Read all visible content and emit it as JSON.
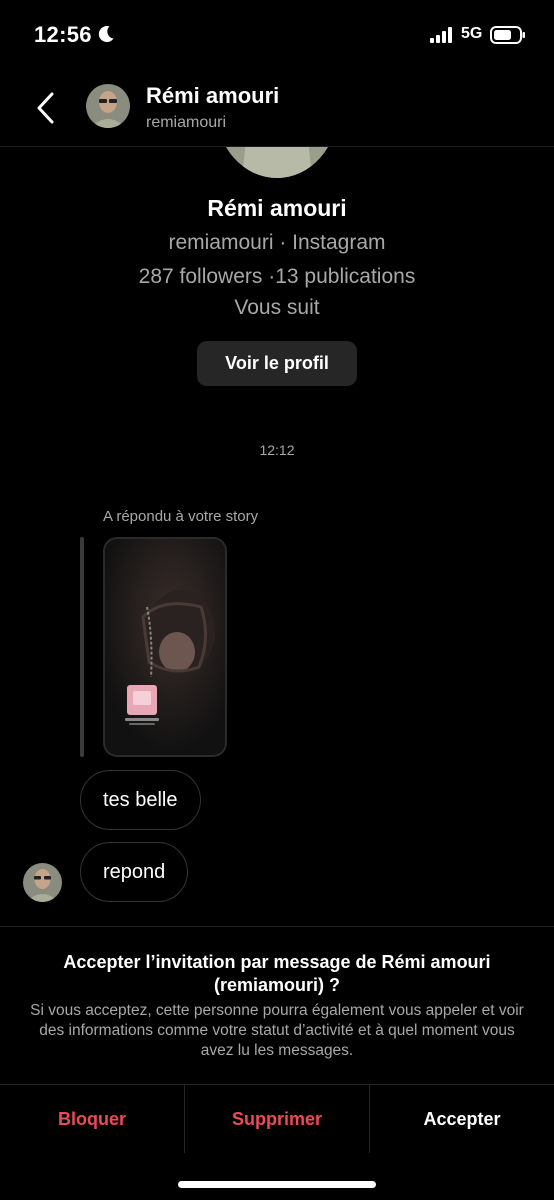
{
  "status_bar": {
    "time": "12:56",
    "network": "5G"
  },
  "header": {
    "name": "Rémi amouri",
    "username": "remiamouri"
  },
  "profile": {
    "name": "Rémi amouri",
    "subtitle": "remiamouri · Instagram",
    "stats": "287 followers ·13 publications",
    "follow_status": "Vous suit",
    "view_profile_label": "Voir le profil"
  },
  "conversation": {
    "timestamp": "12:12",
    "story_reply_label": "A répondu à votre story",
    "messages": [
      {
        "text": "tes belle"
      },
      {
        "text": "repond"
      }
    ]
  },
  "invitation": {
    "title": "Accepter l’invitation par message de Rémi amouri (remiamouri) ?",
    "description": "Si vous acceptez, cette personne pourra également vous appeler et voir des informations comme votre statut d’activité et à quel moment vous avez lu les messages.",
    "actions": {
      "block": "Bloquer",
      "delete": "Supprimer",
      "accept": "Accepter"
    }
  },
  "colors": {
    "background": "#000000",
    "secondary_text": "#a8a8a8",
    "danger": "#ed4956",
    "button_bg": "#262626"
  }
}
